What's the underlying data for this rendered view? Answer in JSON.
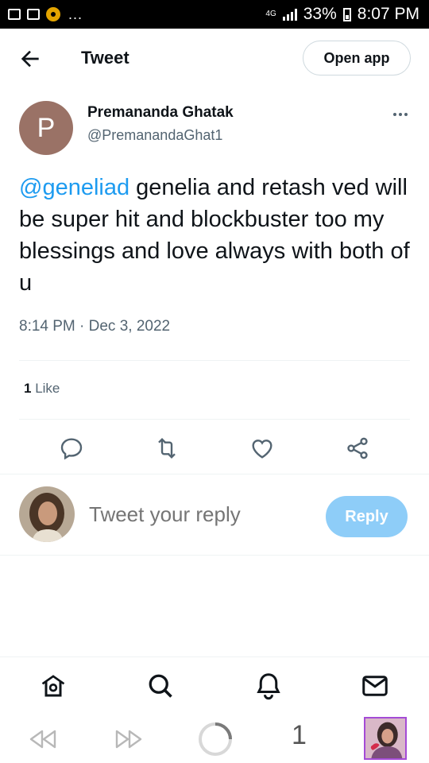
{
  "status_bar": {
    "left_icons": [
      "image-icon",
      "camera-icon",
      "app-icon"
    ],
    "overflow": "...",
    "network": "4G",
    "battery": "33%",
    "time": "8:07 PM"
  },
  "header": {
    "title": "Tweet",
    "open_app_label": "Open app"
  },
  "tweet": {
    "avatar_letter": "P",
    "avatar_color": "#9a7266",
    "display_name": "Premananda Ghatak",
    "handle": "@PremanandaGhat1",
    "mention": "@geneliad",
    "body": " genelia and retash ved will be super hit and blockbuster too my blessings and love always with both of u",
    "timestamp": "8:14 PM · Dec 3, 2022",
    "like_count": "1",
    "like_label": " Like"
  },
  "actions": [
    "reply-icon",
    "retweet-icon",
    "like-icon",
    "share-icon"
  ],
  "reply": {
    "placeholder": "Tweet your reply",
    "button_label": "Reply"
  },
  "bottom_nav": [
    "home-icon",
    "search-icon",
    "notifications-icon",
    "messages-icon"
  ],
  "browser": {
    "tab_count": "1"
  },
  "colors": {
    "accent": "#1d9bf0",
    "reply_button": "#8ecdf8",
    "secondary_text": "#536471"
  }
}
